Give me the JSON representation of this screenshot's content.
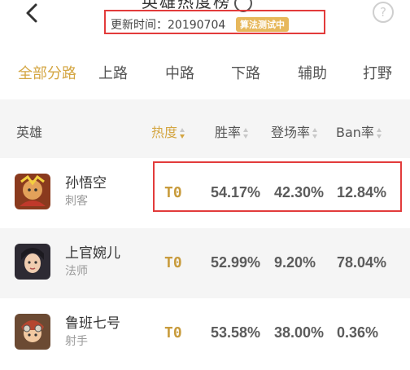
{
  "header": {
    "title_fragment": "英雄热度榜",
    "update_label": "更新时间：20190704",
    "badge": "算法测试中"
  },
  "tabs": [
    {
      "label": "全部分路",
      "active": true
    },
    {
      "label": "上路",
      "active": false
    },
    {
      "label": "中路",
      "active": false
    },
    {
      "label": "下路",
      "active": false
    },
    {
      "label": "辅助",
      "active": false
    },
    {
      "label": "打野",
      "active": false
    }
  ],
  "columns": {
    "hero": "英雄",
    "heat": "热度",
    "win_rate": "胜率",
    "pick_rate": "登场率",
    "ban_rate": "Ban率"
  },
  "rows": [
    {
      "name": "孙悟空",
      "role": "刺客",
      "tier": "T0",
      "win_rate": "54.17%",
      "pick_rate": "42.30%",
      "ban_rate": "12.84%"
    },
    {
      "name": "上官婉儿",
      "role": "法师",
      "tier": "T0",
      "win_rate": "52.99%",
      "pick_rate": "9.20%",
      "ban_rate": "78.04%"
    },
    {
      "name": "鲁班七号",
      "role": "射手",
      "tier": "T0",
      "win_rate": "53.58%",
      "pick_rate": "38.00%",
      "ban_rate": "0.36%"
    }
  ],
  "colors": {
    "accent": "#d4a643",
    "annotation_red": "#e23b3b",
    "header_bg": "#f5f5f5"
  },
  "icons": {
    "back": "chevron-left-icon",
    "help": "question-circle-icon",
    "sort": "sort-arrows-icon"
  }
}
